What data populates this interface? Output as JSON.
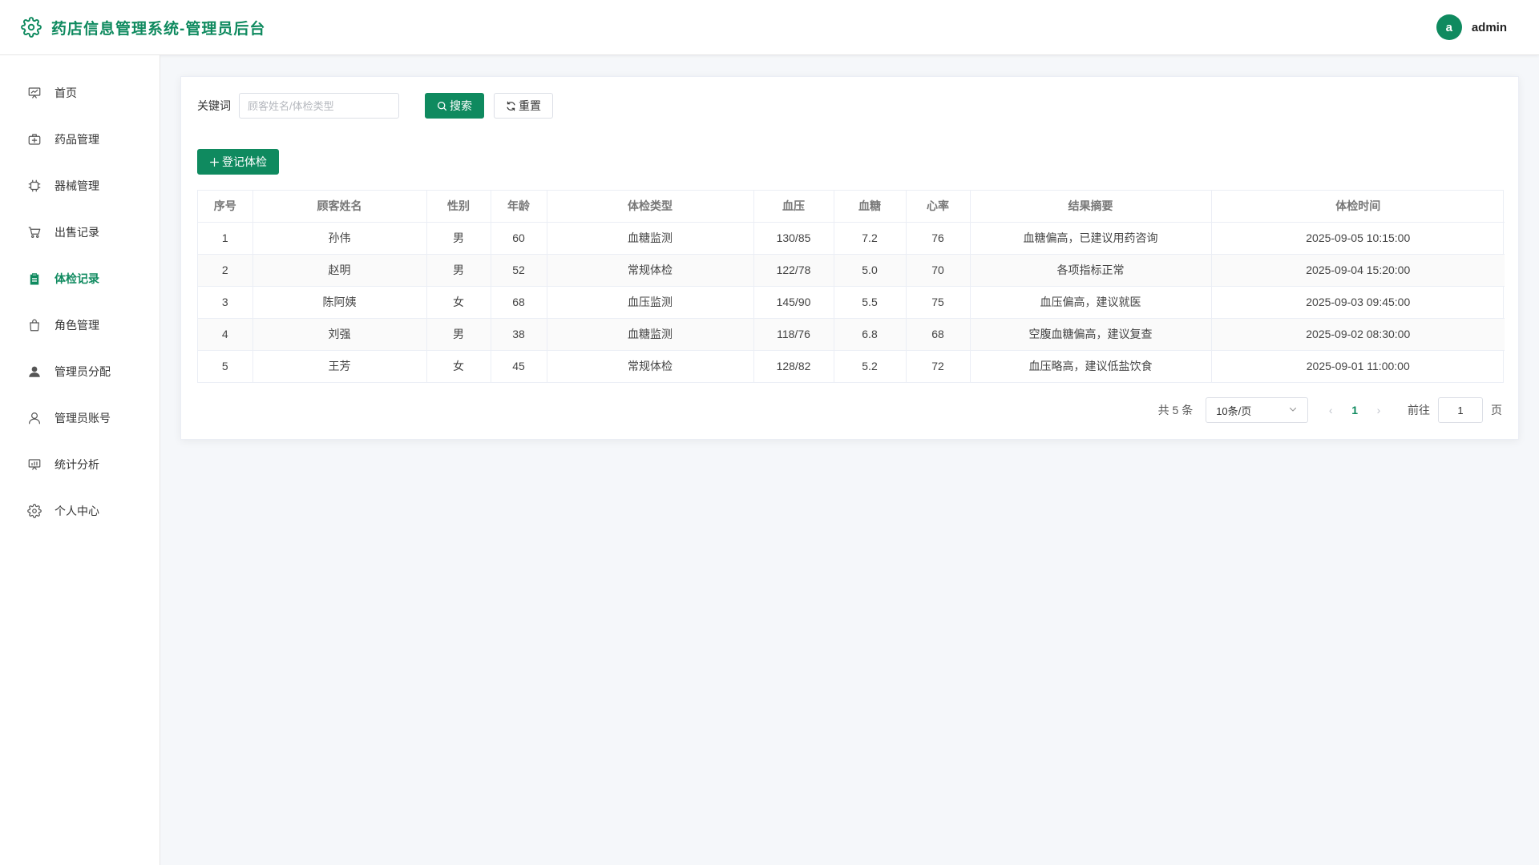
{
  "header": {
    "title": "药店信息管理系统-管理员后台",
    "avatar_letter": "a",
    "username": "admin",
    "accent": "#0f8a5f"
  },
  "sidebar": {
    "items": [
      {
        "label": "首页",
        "icon": "dashboard-icon",
        "active": false
      },
      {
        "label": "药品管理",
        "icon": "medicine-box-icon",
        "active": false
      },
      {
        "label": "器械管理",
        "icon": "chip-icon",
        "active": false
      },
      {
        "label": "出售记录",
        "icon": "cart-icon",
        "active": false
      },
      {
        "label": "体检记录",
        "icon": "clipboard-icon",
        "active": true
      },
      {
        "label": "角色管理",
        "icon": "bag-icon",
        "active": false
      },
      {
        "label": "管理员分配",
        "icon": "user-filled-icon",
        "active": false
      },
      {
        "label": "管理员账号",
        "icon": "user-outline-icon",
        "active": false
      },
      {
        "label": "统计分析",
        "icon": "chart-board-icon",
        "active": false
      },
      {
        "label": "个人中心",
        "icon": "settings-icon",
        "active": false
      }
    ]
  },
  "search": {
    "label": "关键词",
    "placeholder": "顾客姓名/体检类型",
    "value": "",
    "search_button": "搜索",
    "reset_button": "重置"
  },
  "actions": {
    "add_button": "登记体检"
  },
  "table": {
    "columns": [
      "序号",
      "顾客姓名",
      "性别",
      "年龄",
      "体检类型",
      "血压",
      "血糖",
      "心率",
      "结果摘要",
      "体检时间"
    ],
    "rows": [
      [
        "1",
        "孙伟",
        "男",
        "60",
        "血糖监测",
        "130/85",
        "7.2",
        "76",
        "血糖偏高，已建议用药咨询",
        "2025-09-05 10:15:00"
      ],
      [
        "2",
        "赵明",
        "男",
        "52",
        "常规体检",
        "122/78",
        "5.0",
        "70",
        "各项指标正常",
        "2025-09-04 15:20:00"
      ],
      [
        "3",
        "陈阿姨",
        "女",
        "68",
        "血压监测",
        "145/90",
        "5.5",
        "75",
        "血压偏高，建议就医",
        "2025-09-03 09:45:00"
      ],
      [
        "4",
        "刘强",
        "男",
        "38",
        "血糖监测",
        "118/76",
        "6.8",
        "68",
        "空腹血糖偏高，建议复查",
        "2025-09-02 08:30:00"
      ],
      [
        "5",
        "王芳",
        "女",
        "45",
        "常规体检",
        "128/82",
        "5.2",
        "72",
        "血压略高，建议低盐饮食",
        "2025-09-01 11:00:00"
      ]
    ]
  },
  "pagination": {
    "total": "共 5 条",
    "page_size": "10条/页",
    "current_page": "1",
    "goto_label": "前往",
    "goto_value": "1",
    "page_suffix": "页"
  }
}
